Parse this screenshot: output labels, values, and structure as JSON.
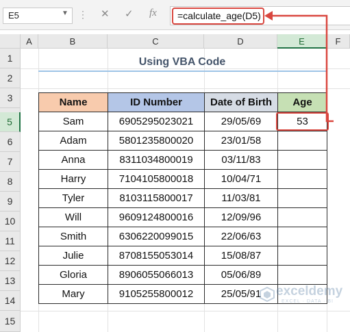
{
  "formula_bar": {
    "name_box": "E5",
    "cancel_icon": "✕",
    "enter_icon": "✓",
    "fx_label": "fx",
    "formula": "=calculate_age(D5)"
  },
  "grid": {
    "columns": [
      "A",
      "B",
      "C",
      "D",
      "E",
      "F"
    ],
    "selected_column": "E",
    "rows": [
      "1",
      "2",
      "3",
      "4",
      "5",
      "6",
      "7",
      "8",
      "9",
      "10",
      "11",
      "12",
      "13",
      "14",
      "15"
    ],
    "selected_row": "5"
  },
  "sheet": {
    "title": "Using VBA Code",
    "table": {
      "headers": [
        "Name",
        "ID Number",
        "Date of Birth",
        "Age"
      ],
      "rows": [
        [
          "Sam",
          "6905295023021",
          "29/05/69",
          "53"
        ],
        [
          "Adam",
          "5801235800020",
          "23/01/58",
          ""
        ],
        [
          "Anna",
          "8311034800019",
          "03/11/83",
          ""
        ],
        [
          "Harry",
          "7104105800018",
          "10/04/71",
          ""
        ],
        [
          "Tyler",
          "8103115800017",
          "11/03/81",
          ""
        ],
        [
          "Will",
          "9609124800016",
          "12/09/96",
          ""
        ],
        [
          "Smith",
          "6306220099015",
          "22/06/63",
          ""
        ],
        [
          "Julie",
          "8708155053014",
          "15/08/87",
          ""
        ],
        [
          "Gloria",
          "8906055066013",
          "05/06/89",
          ""
        ],
        [
          "Mary",
          "9105255800012",
          "25/05/91",
          ""
        ]
      ]
    }
  },
  "annotation": {
    "highlight_color": "#d9473f"
  },
  "watermark": {
    "name": "exceldemy",
    "tagline": "EXCEL · DATA · BI"
  }
}
